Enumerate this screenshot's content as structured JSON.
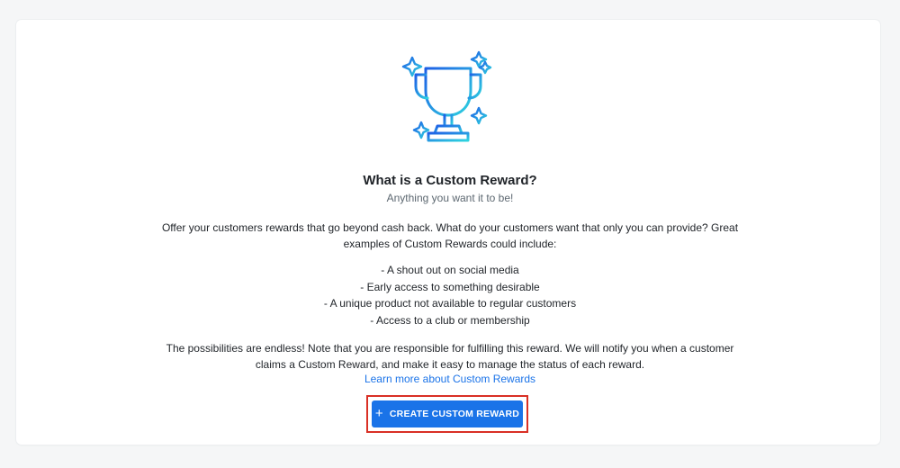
{
  "colors": {
    "background": "#f5f6f7",
    "card": "#ffffff",
    "accent": "#1a73e8",
    "highlight": "#d93025",
    "trophy_gradient_start": "#1e5fe6",
    "trophy_gradient_end": "#2ed3df"
  },
  "illustration": {
    "icon": "trophy-icon",
    "decorations": [
      "sparkle-icon",
      "sparkle-icon",
      "sparkle-icon",
      "sparkle-icon",
      "sparkle-icon"
    ]
  },
  "content": {
    "title": "What is a Custom Reward?",
    "subtitle": "Anything you want it to be!",
    "intro": "Offer your customers rewards that go beyond cash back. What do your customers want that only you can provide? Great examples of Custom Rewards could include:",
    "examples": [
      "- A shout out on social media",
      "- Early access to something desirable",
      "- A unique product not available to regular customers",
      "- Access to a club or membership"
    ],
    "closing": "The possibilities are endless! Note that you are responsible for fulfilling this reward. We will notify you when a customer claims a Custom Reward, and make it easy to manage the status of each reward.",
    "learn_more_link": "Learn more about Custom Rewards"
  },
  "actions": {
    "create_icon": "plus-icon",
    "create_icon_glyph": "+",
    "create_label": "CREATE CUSTOM REWARD"
  }
}
